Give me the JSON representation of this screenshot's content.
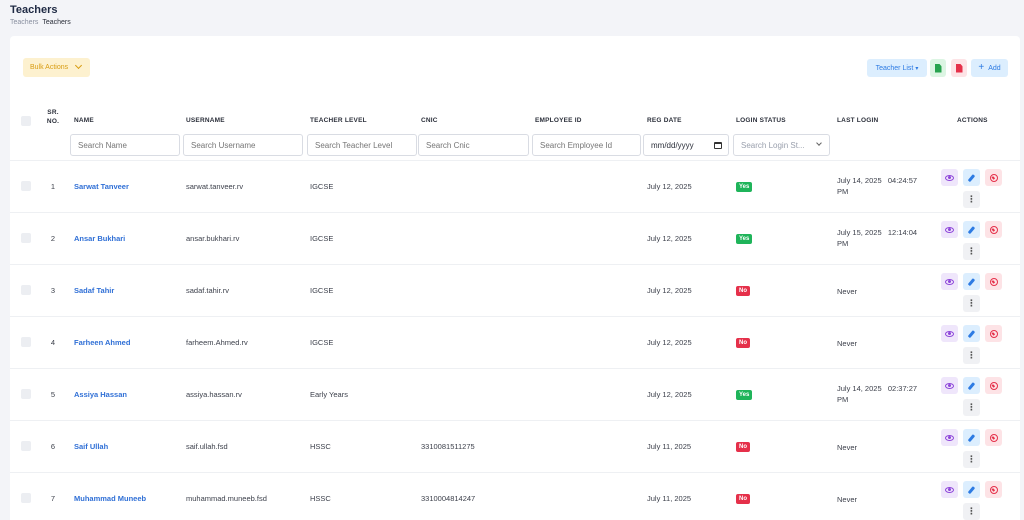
{
  "page": {
    "title": "Teachers",
    "breadcrumb": [
      "Teachers",
      "Teachers"
    ]
  },
  "toolbar": {
    "bulk_actions": "Bulk Actions",
    "teacher_list": "Teacher List",
    "excel_icon": "excel-file-icon",
    "pdf_icon": "pdf-file-icon",
    "add": "Add"
  },
  "columns": {
    "sr_line1": "SR.",
    "sr_line2": "NO.",
    "name": "NAME",
    "username": "USERNAME",
    "teacher_level": "TEACHER LEVEL",
    "cnic": "CNIC",
    "employee_id": "EMPLOYEE ID",
    "reg_date": "REG DATE",
    "login_status": "LOGIN STATUS",
    "last_login": "LAST LOGIN",
    "actions": "ACTIONS"
  },
  "filters": {
    "name": "Search Name",
    "username": "Search Username",
    "teacher_level": "Search Teacher Level",
    "cnic": "Search Cnic",
    "employee_id": "Search Employee Id",
    "reg_date": "mm/dd/yyyy",
    "login_status": "Search Login St..."
  },
  "rows": [
    {
      "sr": "1",
      "name": "Sarwat Tanveer",
      "username": "sarwat.tanveer.rv",
      "level": "IGCSE",
      "cnic": "",
      "employee_id": "",
      "reg_date": "July 12, 2025",
      "status": "Yes",
      "last_login_1": "July 14, 2025   04:24:57",
      "last_login_2": "PM"
    },
    {
      "sr": "2",
      "name": "Ansar Bukhari",
      "username": "ansar.bukhari.rv",
      "level": "IGCSE",
      "cnic": "",
      "employee_id": "",
      "reg_date": "July 12, 2025",
      "status": "Yes",
      "last_login_1": "July 15, 2025   12:14:04",
      "last_login_2": "PM"
    },
    {
      "sr": "3",
      "name": "Sadaf Tahir",
      "username": "sadaf.tahir.rv",
      "level": "IGCSE",
      "cnic": "",
      "employee_id": "",
      "reg_date": "July 12, 2025",
      "status": "No",
      "last_login_1": "Never",
      "last_login_2": ""
    },
    {
      "sr": "4",
      "name": "Farheen Ahmed",
      "username": "farheem.Ahmed.rv",
      "level": "IGCSE",
      "cnic": "",
      "employee_id": "",
      "reg_date": "July 12, 2025",
      "status": "No",
      "last_login_1": "Never",
      "last_login_2": ""
    },
    {
      "sr": "5",
      "name": "Assiya Hassan",
      "username": "assiya.hassan.rv",
      "level": "Early Years",
      "cnic": "",
      "employee_id": "",
      "reg_date": "July 12, 2025",
      "status": "Yes",
      "last_login_1": "July 14, 2025   02:37:27",
      "last_login_2": "PM"
    },
    {
      "sr": "6",
      "name": "Saif Ullah",
      "username": "saif.ullah.fsd",
      "level": "HSSC",
      "cnic": "3310081511275",
      "employee_id": "",
      "reg_date": "July 11, 2025",
      "status": "No",
      "last_login_1": "Never",
      "last_login_2": ""
    },
    {
      "sr": "7",
      "name": "Muhammad Muneeb",
      "username": "muhammad.muneeb.fsd",
      "level": "HSSC",
      "cnic": "3310004814247",
      "employee_id": "",
      "reg_date": "July 11, 2025",
      "status": "No",
      "last_login_1": "Never",
      "last_login_2": ""
    }
  ],
  "colors": {
    "accent": "#2d7be3",
    "yes": "#1fb45a",
    "no": "#e5304a",
    "bulk": "#d89c12"
  }
}
